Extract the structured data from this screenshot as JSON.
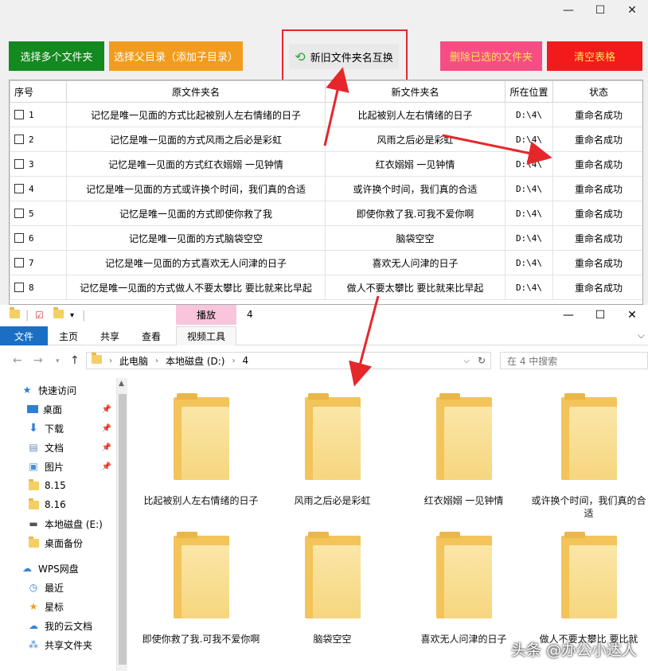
{
  "tool": {
    "win_controls": [
      "—",
      "☐",
      "✕"
    ],
    "buttons": {
      "select_multi": "选择多个文件夹",
      "select_parent": "选择父目录（添加子目录）",
      "swap": "新旧文件夹名互换",
      "delete_selected": "删除已选的文件夹",
      "clear_table": "清空表格"
    },
    "colors": {
      "green": "#13891f",
      "orange": "#f29c1f",
      "pink": "#f64d85",
      "red": "#f21a1a",
      "highlight": "#e5272b"
    },
    "columns": [
      "序号",
      "原文件夹名",
      "新文件夹名",
      "所在位置",
      "状态"
    ],
    "rows": [
      {
        "idx": "1",
        "old": "记忆是唯一见面的方式比起被别人左右情绪的日子",
        "new": "比起被别人左右情绪的日子",
        "loc": "D:\\4\\",
        "status": "重命名成功"
      },
      {
        "idx": "2",
        "old": "记忆是唯一见面的方式风雨之后必是彩虹",
        "new": "风雨之后必是彩虹",
        "loc": "D:\\4\\",
        "status": "重命名成功"
      },
      {
        "idx": "3",
        "old": "记忆是唯一见面的方式红衣嫋嫋 一见钟情",
        "new": "红衣嫋嫋 一见钟情",
        "loc": "D:\\4\\",
        "status": "重命名成功"
      },
      {
        "idx": "4",
        "old": "记忆是唯一见面的方式或许换个时间，我们真的合适",
        "new": "或许换个时间，我们真的合适",
        "loc": "D:\\4\\",
        "status": "重命名成功"
      },
      {
        "idx": "5",
        "old": "记忆是唯一见面的方式即使你救了我",
        "new": "即使你救了我.可我不爱你啊",
        "loc": "D:\\4\\",
        "status": "重命名成功"
      },
      {
        "idx": "6",
        "old": "记忆是唯一见面的方式脑袋空空",
        "new": "脑袋空空",
        "loc": "D:\\4\\",
        "status": "重命名成功"
      },
      {
        "idx": "7",
        "old": "记忆是唯一见面的方式喜欢无人问津的日子",
        "new": "喜欢无人问津的日子",
        "loc": "D:\\4\\",
        "status": "重命名成功"
      },
      {
        "idx": "8",
        "old": "记忆是唯一见面的方式做人不要太攀比 要比就来比早起",
        "new": "做人不要太攀比 要比就来比早起",
        "loc": "D:\\4\\",
        "status": "重命名成功"
      }
    ]
  },
  "explorer": {
    "context_tab": "播放",
    "title": "4",
    "win_controls": [
      "—",
      "☐",
      "✕"
    ],
    "ribbon_tabs": [
      "文件",
      "主页",
      "共享",
      "查看",
      "视频工具"
    ],
    "path": [
      "此电脑",
      "本地磁盘 (D:)",
      "4"
    ],
    "search_placeholder": "在 4 中搜索",
    "nav": [
      {
        "label": "快速访问",
        "icon": "star-icon"
      },
      {
        "label": "桌面",
        "icon": "desktop-icon",
        "pinned": true
      },
      {
        "label": "下载",
        "icon": "download-icon",
        "pinned": true
      },
      {
        "label": "文档",
        "icon": "document-icon",
        "pinned": true
      },
      {
        "label": "图片",
        "icon": "picture-icon",
        "pinned": true
      },
      {
        "label": "8.15",
        "icon": "folder-icon"
      },
      {
        "label": "8.16",
        "icon": "folder-icon"
      },
      {
        "label": "本地磁盘 (E:)",
        "icon": "drive-icon"
      },
      {
        "label": "桌面备份",
        "icon": "folder-icon"
      },
      {
        "label": "WPS网盘",
        "icon": "cloud-icon"
      },
      {
        "label": "最近",
        "icon": "clock-icon"
      },
      {
        "label": "星标",
        "icon": "star-icon"
      },
      {
        "label": "我的云文档",
        "icon": "cloud-icon"
      },
      {
        "label": "共享文件夹",
        "icon": "share-icon"
      }
    ],
    "folders": [
      "比起被别人左右情绪的日子",
      "风雨之后必是彩虹",
      "红衣嫋嫋 一见钟情",
      "或许换个时间，我们真的合适",
      "即使你救了我.可我不爱你啊",
      "脑袋空空",
      "喜欢无人问津的日子",
      "做人不要太攀比 要比就"
    ]
  },
  "watermark": "头条 @办公小达人"
}
